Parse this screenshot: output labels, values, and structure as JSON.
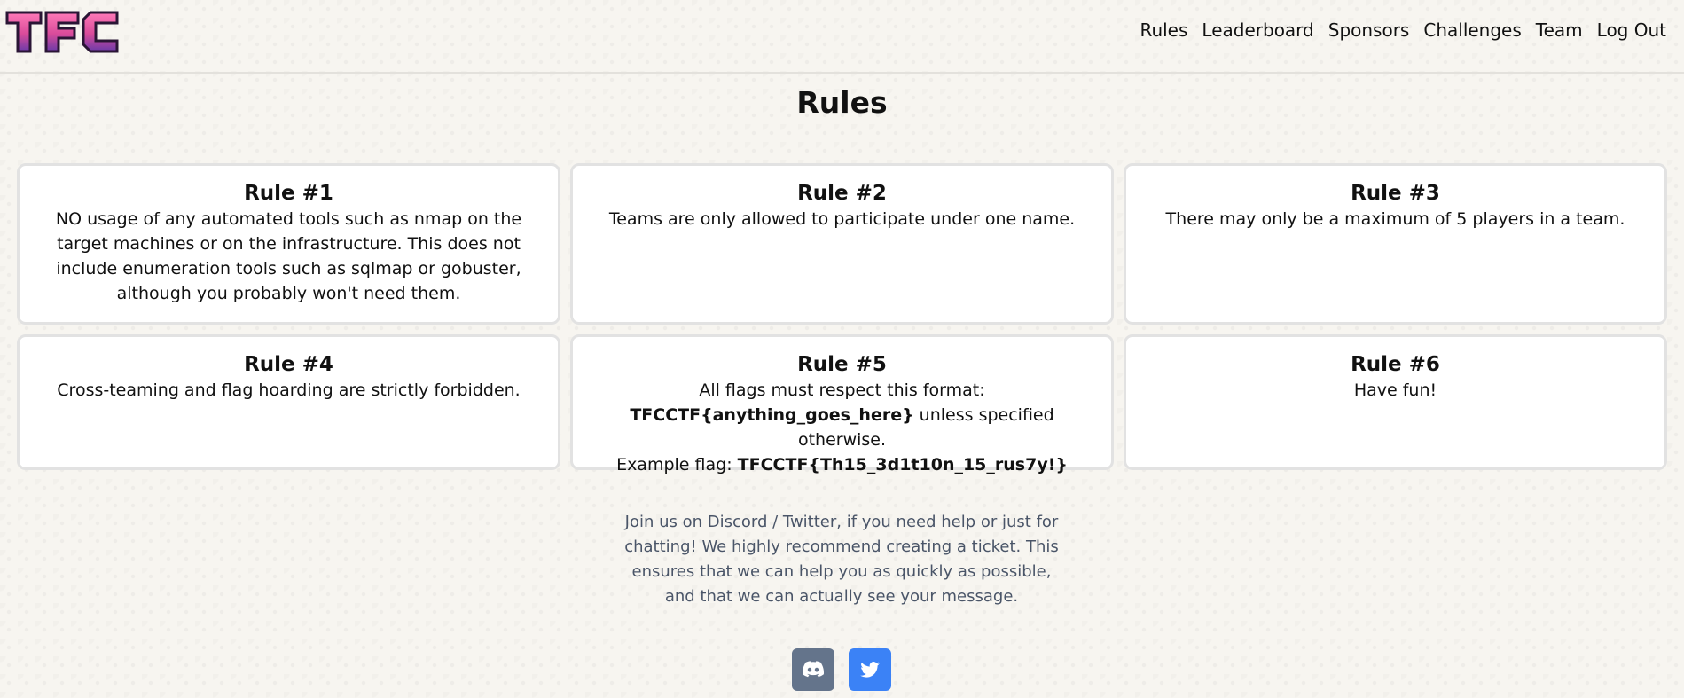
{
  "header": {
    "logo_text": "TFC",
    "nav": [
      "Rules",
      "Leaderboard",
      "Sponsors",
      "Challenges",
      "Team",
      "Log Out"
    ]
  },
  "page_title": "Rules",
  "rules": [
    {
      "title": "Rule #1",
      "text": "NO usage of any automated tools such as nmap on the target machines or on the infrastructure. This does not include enumeration tools such as sqlmap or gobuster, although you probably won't need them."
    },
    {
      "title": "Rule #2",
      "text": "Teams are only allowed to participate under one name."
    },
    {
      "title": "Rule #3",
      "text": "There may only be a maximum of 5 players in a team."
    },
    {
      "title": "Rule #4",
      "text": "Cross-teaming and flag hoarding are strictly forbidden."
    },
    {
      "title": "Rule #5",
      "line1": "All flags must respect this format:",
      "format": "TFCCTF{anything_goes_here}",
      "line2_rest": " unless specified otherwise.",
      "example_label": "Example flag: ",
      "example_flag": "TFCCTF{Th15_3d1t10n_15_rus7y!}"
    },
    {
      "title": "Rule #6",
      "text": "Have fun!"
    }
  ],
  "footer": {
    "text": "Join us on Discord / Twitter, if you need help or just for chatting! We highly recommend creating a ticket. This ensures that we can help you as quickly as possible, and that we can actually see your message.",
    "social_icons": [
      "discord-icon",
      "twitter-icon"
    ]
  },
  "colors": {
    "discord_button": "#64748b",
    "twitter_button": "#3b82f6",
    "logo_pink": "#e0559b",
    "logo_purple": "#7a3fb0"
  }
}
